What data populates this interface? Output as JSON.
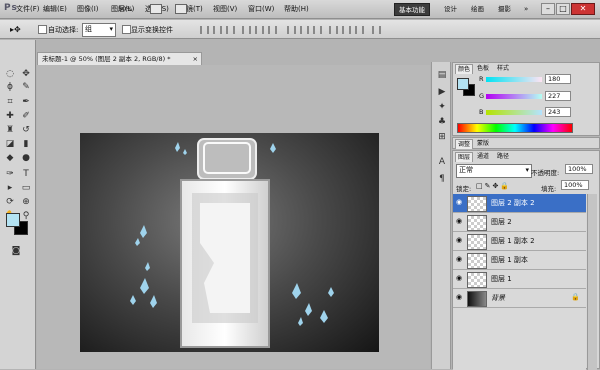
{
  "app": {
    "logo": "Ps"
  },
  "menu": [
    "文件(F)",
    "编辑(E)",
    "图像(I)",
    "图层(L)",
    "选择(S)",
    "滤镜(T)",
    "视图(V)",
    "窗口(W)",
    "帮助(H)"
  ],
  "zoom_display": "50%",
  "workspaces": [
    "基本功能",
    "设计",
    "绘画",
    "摄影"
  ],
  "active_workspace_index": 0,
  "options_bar": {
    "auto_select_label": "自动选择:",
    "auto_select_value": "组",
    "show_transform_label": "显示变换控件"
  },
  "document_tab": {
    "title": "未标题-1 @ 50% (图层 2 副本 2, RGB/8) *",
    "close": "×"
  },
  "color_panel": {
    "tabs": [
      "颜色",
      "色板",
      "样式"
    ],
    "channels": [
      {
        "label": "R",
        "value": "180"
      },
      {
        "label": "G",
        "value": "227"
      },
      {
        "label": "B",
        "value": "243"
      }
    ],
    "foreground_color": "#b4e3f3"
  },
  "adjust_tabs": [
    "调整",
    "蒙版"
  ],
  "layers_panel": {
    "tabs": [
      "图层",
      "通道",
      "路径"
    ],
    "blend_mode": "正常",
    "opacity_label": "不透明度:",
    "opacity_value": "100%",
    "lock_label": "锁定:",
    "fill_label": "填充:",
    "fill_value": "100%",
    "layers": [
      {
        "name": "图层 2 副本 2",
        "selected": true
      },
      {
        "name": "图层 2",
        "selected": false
      },
      {
        "name": "图层 1 副本 2",
        "selected": false
      },
      {
        "name": "图层 1 副本",
        "selected": false
      },
      {
        "name": "图层 1",
        "selected": false
      },
      {
        "name": "背景",
        "selected": false,
        "locked": true
      }
    ]
  },
  "colors": {
    "selection": "#3a6fc6",
    "accent_active": "#3c3c3c"
  }
}
